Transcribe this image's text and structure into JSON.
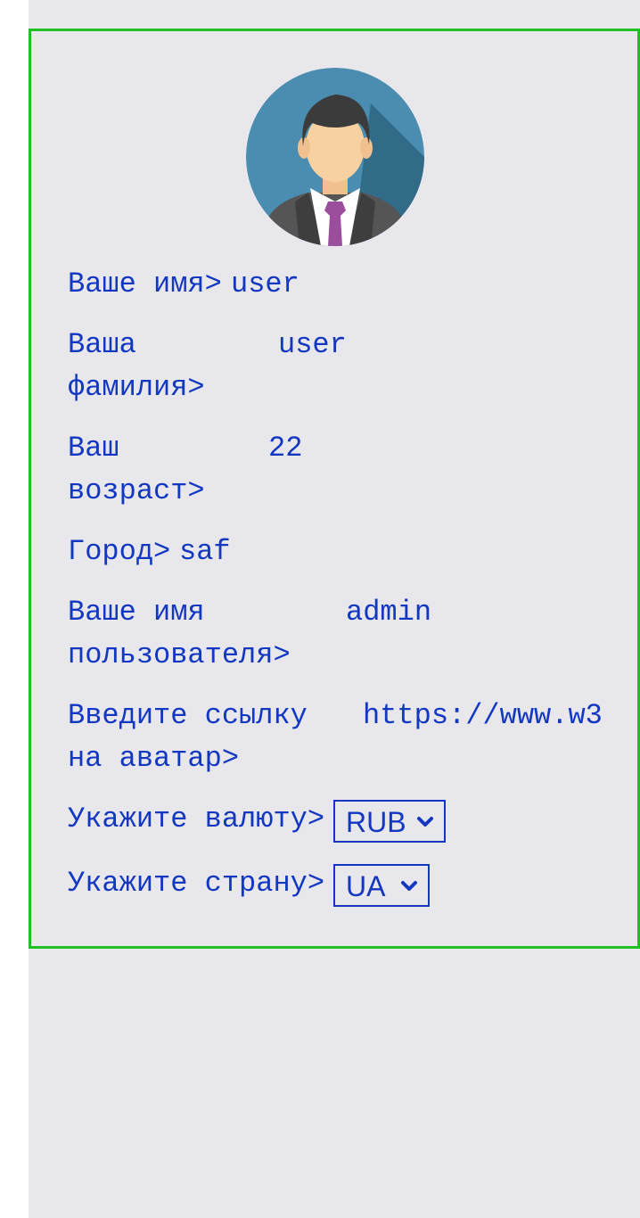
{
  "profile": {
    "fields": [
      {
        "label": "Ваше имя>",
        "value": "user"
      },
      {
        "label_line1": "Ваша",
        "label_line2": "фамилия>",
        "value": "user"
      },
      {
        "label_line1": "Ваш",
        "label_line2": "возраст>",
        "value": "22"
      },
      {
        "label": "Город>",
        "value": "saf"
      },
      {
        "label_line1": "Ваше имя",
        "label_line2": "пользователя>",
        "value": "admin"
      },
      {
        "label_line1": "Введите ссылку",
        "label_line2": "на аватар>",
        "value": "https://www.w3"
      }
    ],
    "currency": {
      "label": "Укажите валюту>",
      "selected": "RUB"
    },
    "country": {
      "label": "Укажите страну>",
      "selected": "UA"
    }
  },
  "colors": {
    "text": "#1237c0",
    "card_border": "#1fbf25",
    "background": "#e8e7eb"
  },
  "icons": {
    "avatar": "businessman-avatar-icon",
    "select_arrow": "chevron-down-icon"
  }
}
